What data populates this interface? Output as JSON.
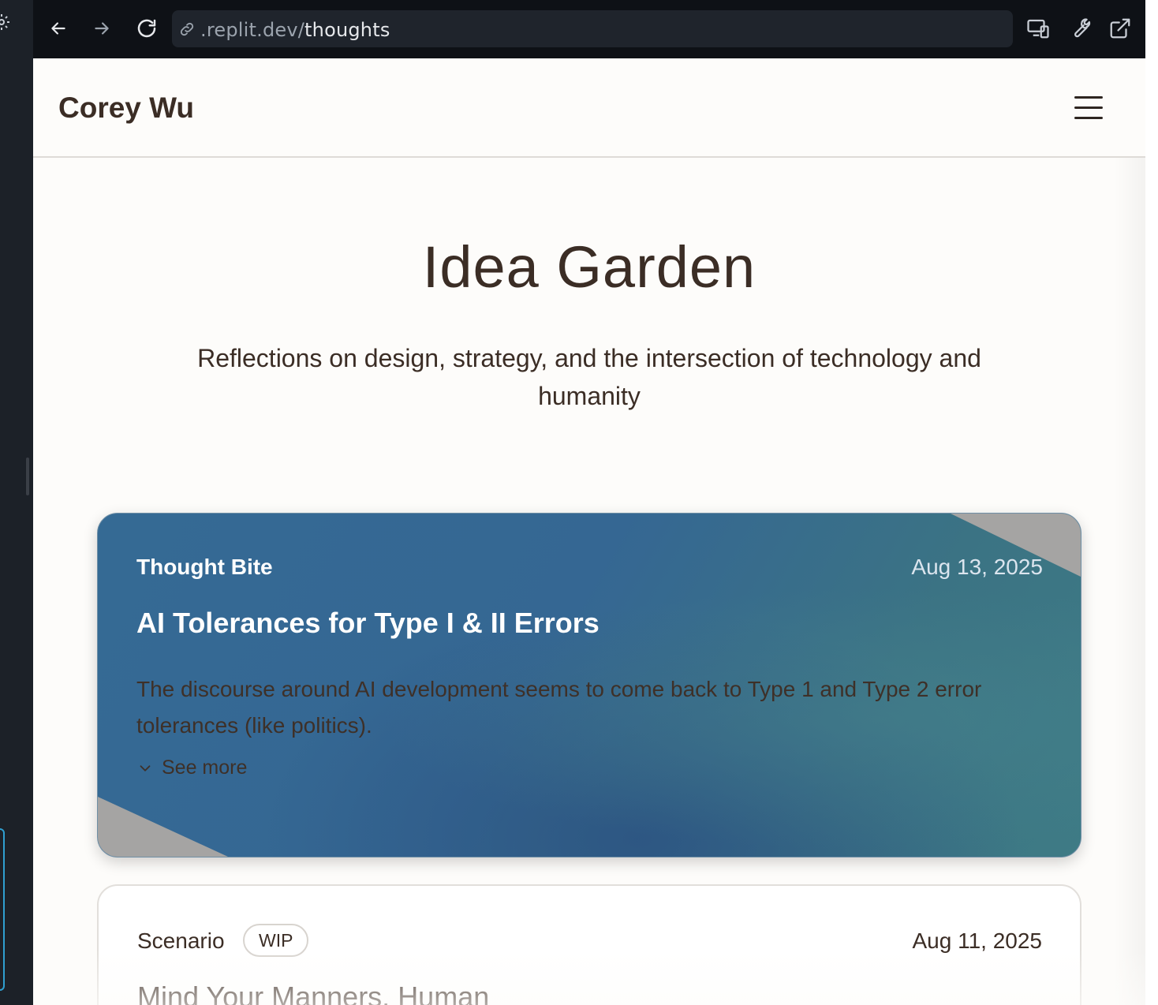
{
  "browser": {
    "url_domain": ".replit.dev/",
    "url_path": "thoughts"
  },
  "site": {
    "brand": "Corey Wu"
  },
  "hero": {
    "title": "Idea Garden",
    "subtitle": "Reflections on design, strategy, and the intersection of technology and humanity"
  },
  "cards": [
    {
      "category": "Thought Bite",
      "date": "Aug 13, 2025",
      "title": "AI Tolerances for Type I & II Errors",
      "excerpt": "The discourse around AI development seems to come back to Type 1 and Type 2 error tolerances (like politics).",
      "see_more": "See more"
    },
    {
      "category": "Scenario",
      "badge": "WIP",
      "date": "Aug 11, 2025",
      "title": "Mind Your Manners, Human"
    }
  ],
  "colors": {
    "featured_card": "#356793",
    "text_brown": "#3b2d25",
    "page_bg": "#fdfcfa"
  }
}
